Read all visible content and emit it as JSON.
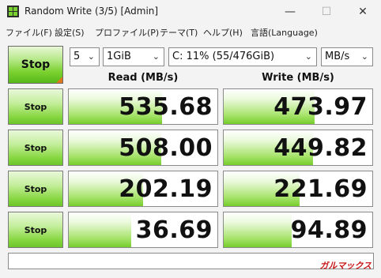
{
  "window": {
    "title": "Random Write (3/5) [Admin]",
    "controls": {
      "minimize": "—",
      "maximize": "☐",
      "close": "✕"
    }
  },
  "menu": [
    "ファイル(F)",
    "設定(S)",
    "プロファイル(P)",
    "テーマ(T)",
    "ヘルプ(H)",
    "言語(Language)"
  ],
  "toolbar": {
    "stop_all_label": "Stop",
    "count": "5",
    "size": "1GiB",
    "drive": "C: 11% (55/476GiB)",
    "unit": "MB/s"
  },
  "headers": {
    "read": "Read (MB/s)",
    "write": "Write (MB/s)"
  },
  "rows": [
    {
      "button": "Stop",
      "read": "535.68",
      "write": "473.97",
      "read_pct": 0.63,
      "write_pct": 0.61
    },
    {
      "button": "Stop",
      "read": "508.00",
      "write": "449.82",
      "read_pct": 0.62,
      "write_pct": 0.6
    },
    {
      "button": "Stop",
      "read": "202.19",
      "write": "221.69",
      "read_pct": 0.5,
      "write_pct": 0.51
    },
    {
      "button": "Stop",
      "read": "36.69",
      "write": "94.89",
      "read_pct": 0.42,
      "write_pct": 0.46
    }
  ],
  "watermark": "ガルマックス",
  "colors": {
    "accent_green": "#76cd2c",
    "orange": "#e2761b"
  }
}
